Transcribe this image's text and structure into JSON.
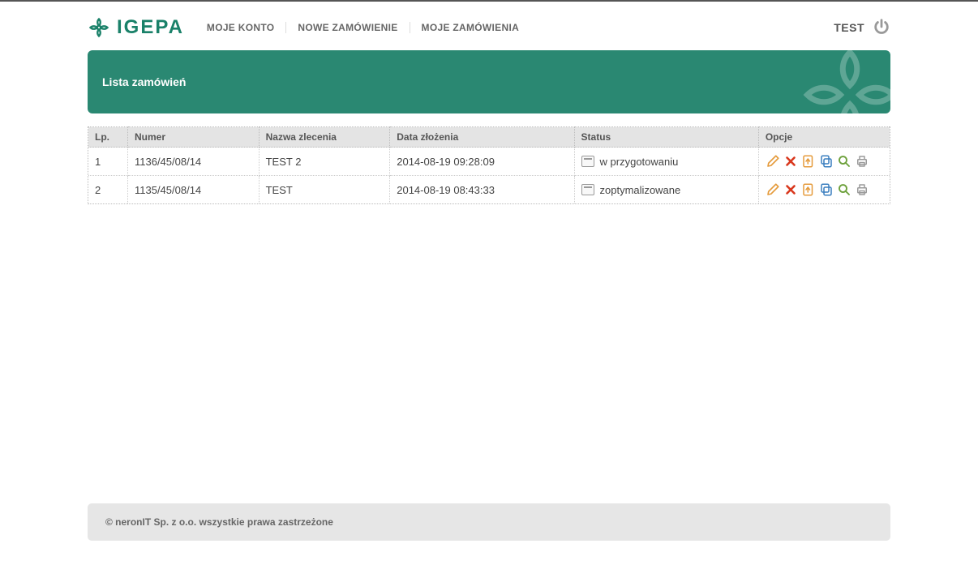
{
  "brand": {
    "name": "IGEPA"
  },
  "nav": {
    "items": [
      {
        "label": "MOJE KONTO"
      },
      {
        "label": "NOWE ZAMÓWIENIE"
      },
      {
        "label": "MOJE ZAMÓWIENIA"
      }
    ]
  },
  "user": {
    "label": "TEST"
  },
  "banner": {
    "title": "Lista zamówień"
  },
  "table": {
    "headers": {
      "lp": "Lp.",
      "numer": "Numer",
      "nazwa": "Nazwa zlecenia",
      "data": "Data złożenia",
      "status": "Status",
      "opcje": "Opcje"
    },
    "rows": [
      {
        "lp": "1",
        "numer": "1136/45/08/14",
        "nazwa": "TEST 2",
        "data": "2014-08-19 09:28:09",
        "status": "w przygotowaniu"
      },
      {
        "lp": "2",
        "numer": "1135/45/08/14",
        "nazwa": "TEST",
        "data": "2014-08-19 08:43:33",
        "status": "zoptymalizowane"
      }
    ]
  },
  "footer": {
    "text": "© neronIT Sp. z o.o. wszystkie prawa zastrzeżone"
  },
  "colors": {
    "brand": "#1a8169",
    "banner": "#2a8872",
    "edit": "#e59b3c",
    "delete": "#d9381e",
    "export": "#e59b3c",
    "copy": "#3a7fbf",
    "zoom": "#6ca03a",
    "print": "#9a9a9a"
  }
}
